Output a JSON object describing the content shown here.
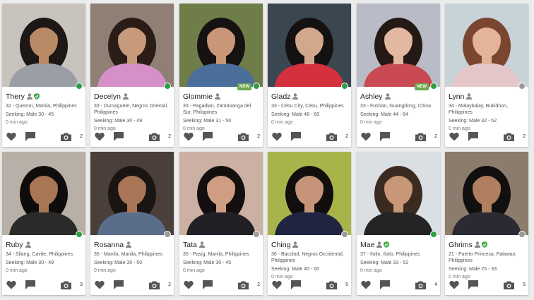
{
  "colors": {
    "online": "#2e9e44",
    "offline": "#9a9a9a",
    "verified": "#4caf50",
    "new_badge": "#6aa84f",
    "icon": "#555555"
  },
  "profiles": [
    {
      "name": "Thery",
      "verified": true,
      "location": "32 - Quezon, Manila, Philippines",
      "seeking": "Seeking: Male 30 - 45",
      "last_seen": "0 min ago",
      "photos": "2",
      "online": true,
      "is_new": false
    },
    {
      "name": "Decelyn",
      "verified": false,
      "location": "33 - Dumaguete, Negros Oriental, Philippines",
      "seeking": "Seeking: Male 30 - 49",
      "last_seen": "0 min ago",
      "photos": "2",
      "online": true,
      "is_new": false
    },
    {
      "name": "Glommie",
      "verified": false,
      "location": "33 - Pagadian, Zamboanga del Sur, Philippines",
      "seeking": "Seeking: Male 31 - 50",
      "last_seen": "0 min ago",
      "photos": "2",
      "online": true,
      "is_new": true,
      "new_label": "NEW"
    },
    {
      "name": "Gladz",
      "verified": false,
      "location": "33 - Cebu City, Cebu, Philippines",
      "seeking": "Seeking: Male 48 - 60",
      "last_seen": "0 min ago",
      "photos": "2",
      "online": true,
      "is_new": false
    },
    {
      "name": "Ashley",
      "verified": false,
      "location": "33 - Foshan, Guangdong, China",
      "seeking": "Seeking: Male 44 - 64",
      "last_seen": "0 min ago",
      "photos": "2",
      "online": true,
      "is_new": true,
      "new_label": "NEW"
    },
    {
      "name": "Lynn",
      "verified": false,
      "location": "34 - Malaybalay, Bukidnon, Philippines",
      "seeking": "Seeking: Male 32 - 52",
      "last_seen": "0 min ago",
      "photos": "2",
      "online": false,
      "is_new": false
    },
    {
      "name": "Ruby",
      "verified": false,
      "location": "34 - Silang, Cavite, Philippines",
      "seeking": "Seeking: Male 30 - 49",
      "last_seen": "0 min ago",
      "photos": "3",
      "online": true,
      "is_new": false
    },
    {
      "name": "Rosanna",
      "verified": false,
      "location": "35 - Manila, Manila, Philippines",
      "seeking": "Seeking: Male 35 - 50",
      "last_seen": "0 min ago",
      "photos": "2",
      "online": false,
      "is_new": false
    },
    {
      "name": "Tata",
      "verified": false,
      "location": "35 - Pasig, Manila, Philippines",
      "seeking": "Seeking: Male 30 - 45",
      "last_seen": "0 min ago",
      "photos": "2",
      "online": false,
      "is_new": false
    },
    {
      "name": "Ching",
      "verified": false,
      "location": "36 - Bacolod, Negros Occidental, Philippines",
      "seeking": "Seeking: Male 40 - 60",
      "last_seen": "0 min ago",
      "photos": "5",
      "online": false,
      "is_new": false
    },
    {
      "name": "Mae",
      "verified": true,
      "location": "37 - Iloilo, Iloilo, Philippines",
      "seeking": "Seeking: Male 33 - 52",
      "last_seen": "0 min ago",
      "photos": "4",
      "online": true,
      "is_new": false
    },
    {
      "name": "Ghrims",
      "verified": true,
      "location": "21 - Puerto Princesa, Palawan, Philippines",
      "seeking": "Seeking: Male 25 - 33",
      "last_seen": "0 min ago",
      "photos": "5",
      "online": false,
      "is_new": false
    }
  ]
}
